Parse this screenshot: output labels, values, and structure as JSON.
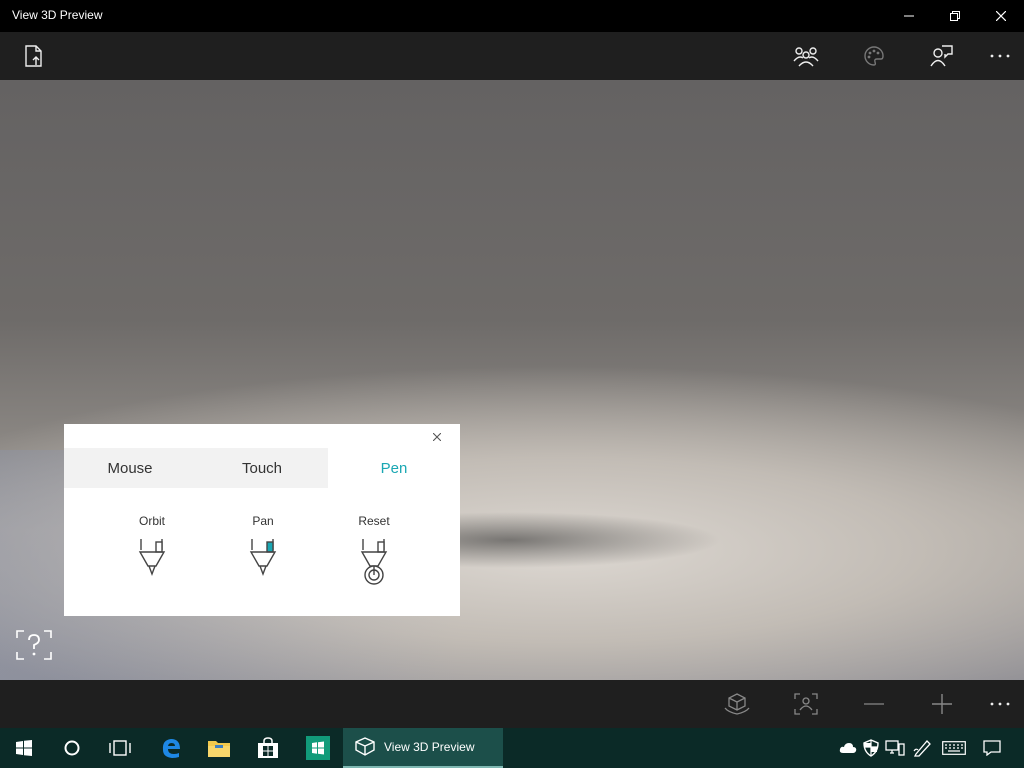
{
  "window": {
    "title": "View 3D Preview",
    "controls": {
      "minimize_icon": "minimize-icon",
      "restore_icon": "restore-icon",
      "close_icon": "close-icon"
    }
  },
  "toolbar": {
    "left": [
      {
        "icon": "open-file-icon"
      }
    ],
    "right": [
      {
        "icon": "people-icon"
      },
      {
        "icon": "palette-icon",
        "disabled": true
      },
      {
        "icon": "feedback-icon"
      },
      {
        "icon": "more-icon"
      }
    ]
  },
  "controls_panel": {
    "tabs": [
      {
        "label": "Mouse",
        "active": false
      },
      {
        "label": "Touch",
        "active": false
      },
      {
        "label": "Pen",
        "active": true
      }
    ],
    "gestures": [
      {
        "label": "Orbit",
        "icon": "pen-orbit-icon"
      },
      {
        "label": "Pan",
        "icon": "pen-pan-icon"
      },
      {
        "label": "Reset",
        "icon": "pen-reset-icon"
      }
    ],
    "accent_color": "#1aa7b3"
  },
  "bottom_toolbar": [
    {
      "icon": "cube-hand-icon"
    },
    {
      "icon": "focus-frame-icon"
    },
    {
      "icon": "zoom-out-icon"
    },
    {
      "icon": "zoom-in-icon"
    },
    {
      "icon": "more-icon"
    }
  ],
  "taskbar": {
    "pinned": [
      "windows-start-icon",
      "cortana-icon",
      "task-view-icon",
      "edge-icon",
      "file-explorer-icon",
      "store-icon",
      "windows-app-icon"
    ],
    "active_app": {
      "label": "View 3D Preview",
      "icon": "view3d-icon"
    },
    "tray": [
      "onedrive-icon",
      "defender-icon",
      "network-icon",
      "pen-workspace-icon",
      "keyboard-icon",
      "action-center-icon"
    ]
  }
}
